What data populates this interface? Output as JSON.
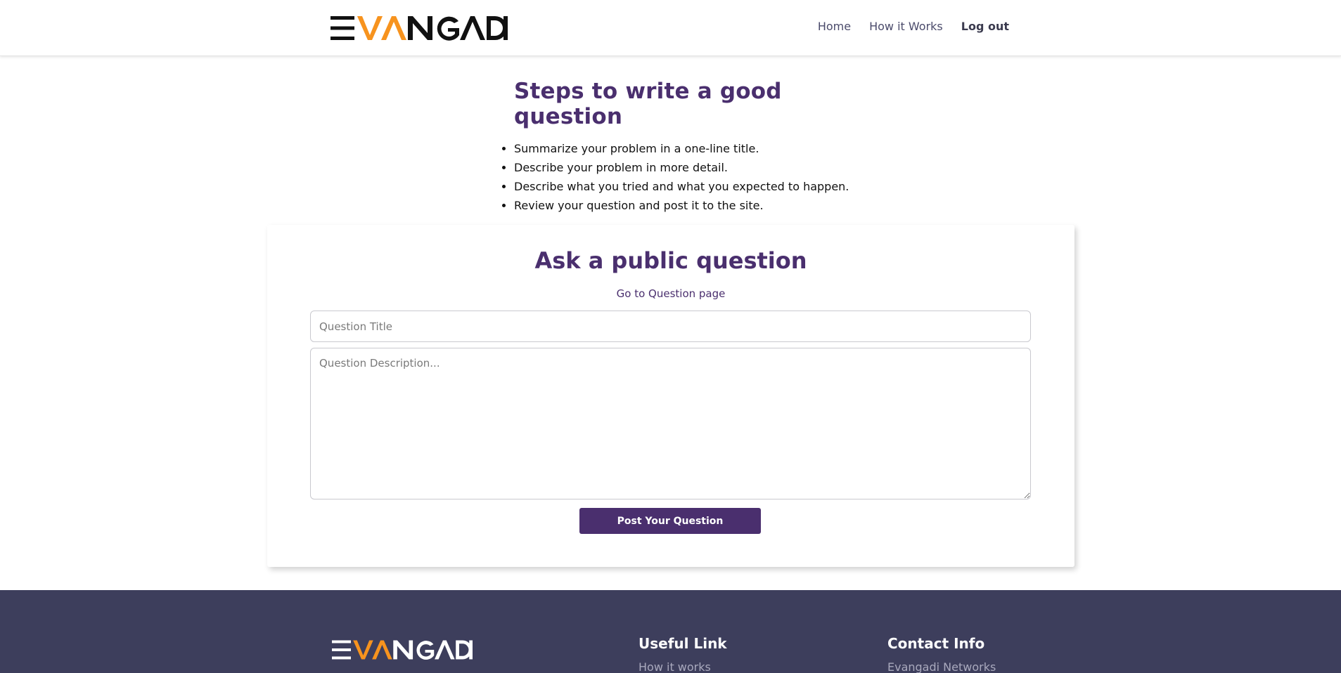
{
  "brand": {
    "name": "EVANGADI",
    "accent": "#f7931e",
    "primary": "#4a2f6e",
    "footer_bg": "#3d3e5c"
  },
  "nav": {
    "home": "Home",
    "how_it_works": "How it Works",
    "logout": "Log out"
  },
  "steps": {
    "title": "Steps to write a good question",
    "items": [
      "Summarize your problem in a one-line title.",
      "Describe your problem in more detail.",
      "Describe what you tried and what you expected to happen.",
      "Review your question and post it to the site."
    ]
  },
  "ask": {
    "title": "Ask a public question",
    "goto_link": "Go to Question page",
    "title_placeholder": "Question Title",
    "title_value": "",
    "description_placeholder": "Question Description...",
    "description_value": "",
    "submit_label": "Post Your Question"
  },
  "footer": {
    "useful_heading": "Useful Link",
    "useful_links": [
      "How it works"
    ],
    "contact_heading": "Contact Info",
    "contact_items": [
      "Evangadi Networks"
    ]
  }
}
